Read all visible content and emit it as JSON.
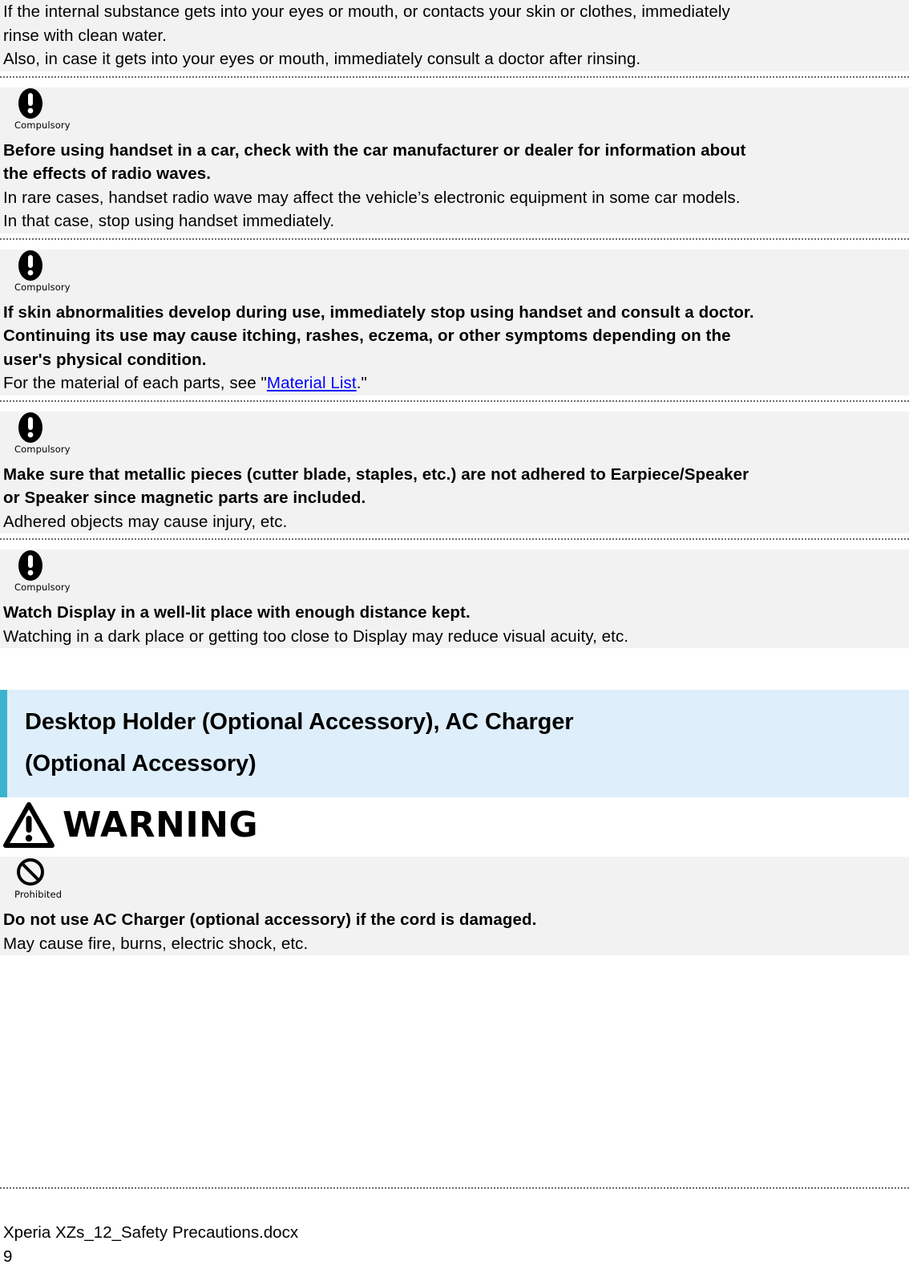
{
  "document": {
    "blocks": [
      {
        "type": "text-block",
        "icon": null,
        "lines": [
          {
            "text": "If the internal substance gets into your eyes or mouth, or contacts your skin or clothes, immediately",
            "bold": false
          },
          {
            "text": "rinse with clean water.",
            "bold": false
          },
          {
            "text": "Also, in case it gets into your eyes or mouth, immediately consult a doctor after rinsing.",
            "bold": false
          }
        ]
      },
      {
        "type": "text-block",
        "icon": {
          "name": "compulsory-icon",
          "label": "Compulsory"
        },
        "lines": [
          {
            "text": "Before using handset in a car, check with the car manufacturer or dealer for information about",
            "bold": true
          },
          {
            "text": "the effects of radio waves.",
            "bold": true
          },
          {
            "text": "In rare cases, handset radio wave may affect the vehicle’s electronic equipment in some car models.",
            "bold": false
          },
          {
            "text": "In that case, stop using handset immediately.",
            "bold": false
          }
        ]
      },
      {
        "type": "text-block",
        "icon": {
          "name": "compulsory-icon",
          "label": "Compulsory"
        },
        "lines": [
          {
            "text": "If skin abnormalities develop during use, immediately stop using handset and consult a doctor.",
            "bold": true
          },
          {
            "text": "Continuing its use may cause itching, rashes, eczema, or other symptoms depending on the",
            "bold": true
          },
          {
            "text": "user's physical condition.",
            "bold": true
          },
          {
            "text": "For the material of each parts, see \"",
            "bold": false,
            "link": "Material List",
            "text_after": ".\""
          }
        ]
      },
      {
        "type": "text-block",
        "icon": {
          "name": "compulsory-icon",
          "label": "Compulsory"
        },
        "lines": [
          {
            "text": "Make sure that metallic pieces (cutter blade, staples, etc.) are not adhered to Earpiece/Speaker",
            "bold": true
          },
          {
            "text": "or Speaker since magnetic parts are included.",
            "bold": true
          },
          {
            "text": "Adhered objects may cause injury, etc.",
            "bold": false
          }
        ]
      },
      {
        "type": "text-block",
        "icon": {
          "name": "compulsory-icon",
          "label": "Compulsory"
        },
        "lines": [
          {
            "text": "Watch Display in a well-lit place with enough distance kept.",
            "bold": true
          },
          {
            "text": "Watching in a dark place or getting too close to Display may reduce visual acuity, etc.",
            "bold": false
          }
        ]
      }
    ],
    "heading": {
      "name": "section-heading",
      "lines": [
        "Desktop Holder (Optional Accessory), AC Charger",
        "(Optional Accessory)"
      ],
      "band_background": "#DEEEFA",
      "accent_bar": "#3BB3CD"
    },
    "warning": {
      "icon_name": "warning-triangle-icon",
      "label": "WARNING"
    },
    "blocks_after_warning": [
      {
        "type": "text-block",
        "icon": {
          "name": "prohibited-icon",
          "label": "Prohibited"
        },
        "lines": [
          {
            "text": "Do not use AC Charger (optional accessory) if the cord is damaged.",
            "bold": true
          },
          {
            "text": "May cause fire, burns, electric shock, etc.",
            "bold": false
          }
        ]
      }
    ],
    "footer": {
      "file_name": "Xperia XZs_12_Safety Precautions.docx",
      "page_number": "9"
    },
    "colors": {
      "block_background": "#F2F2F2",
      "link": "#0000FF",
      "text": "#000000",
      "separator": "#6B6B6B"
    }
  }
}
